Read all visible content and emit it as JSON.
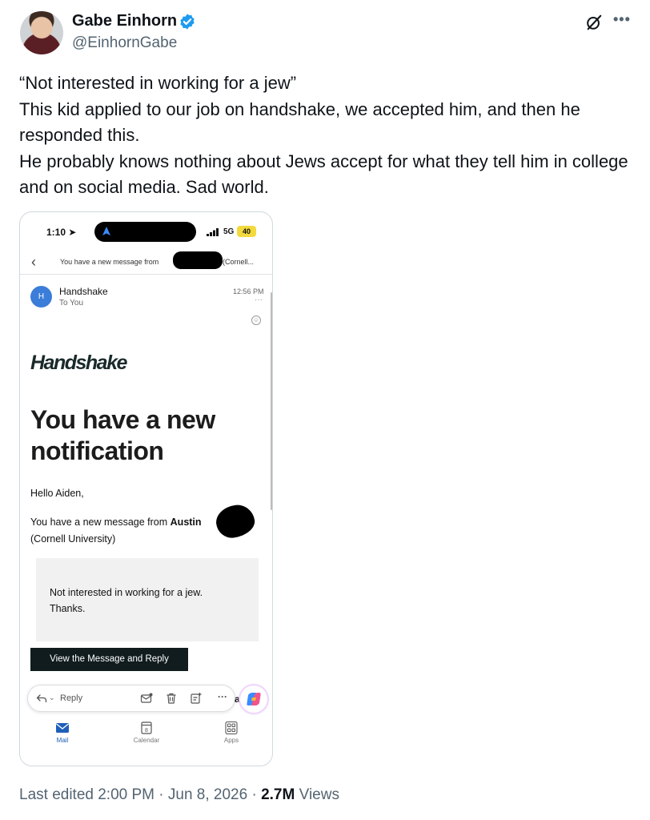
{
  "author": {
    "name": "Gabe Einhorn",
    "handle": "@EinhornGabe",
    "verified": true
  },
  "tweet": {
    "lines": [
      "“Not interested in working for a jew”",
      "This kid applied to our job on handshake, we accepted him, and then he responded this.",
      "He probably knows nothing about Jews accept for what they tell him in college and on social media. Sad world."
    ]
  },
  "phone": {
    "status": {
      "time": "1:10",
      "network": "5G",
      "battery": "40"
    },
    "mail_header": {
      "subject_prefix": "You have a new message from",
      "subject_suffix": "(Cornell...",
      "sender_initial": "H",
      "sender": "Handshake",
      "recipient": "To You",
      "time": "12:56 PM"
    },
    "email": {
      "brand": "Handshake",
      "headline": "You have a new notification",
      "greeting": "Hello Aiden,",
      "message_intro": "You have a new message from",
      "from_name": "Austin",
      "from_school": "(Cornell University)",
      "quote_line_1": "Not interested in working for a jew.",
      "quote_line_2": "Thanks.",
      "button": "View the Message and Reply"
    },
    "reply_bar": {
      "label": "Reply",
      "partial_text": "a"
    },
    "tabs": [
      {
        "label": "Mail",
        "icon": "mail-icon",
        "active": true,
        "color": "#1f5fb8"
      },
      {
        "label": "Calendar",
        "icon": "calendar-icon",
        "badge": "8"
      },
      {
        "label": "Apps",
        "icon": "apps-icon"
      }
    ]
  },
  "footer": {
    "edited": "Last edited 2:00 PM · Jun 8, 2026 ·",
    "views_count": "2.7M",
    "views_label": "Views"
  },
  "colors": {
    "verified": "#1d9bf0",
    "text": "#0f1419",
    "secondary": "#536471"
  }
}
